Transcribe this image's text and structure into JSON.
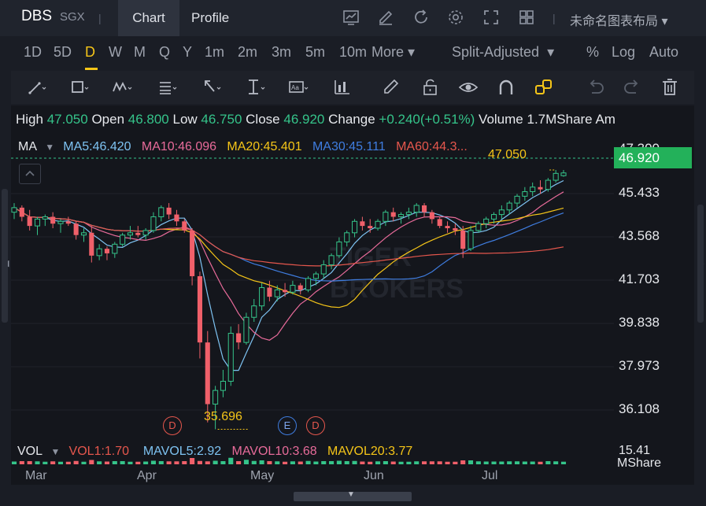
{
  "header": {
    "symbol": "DBS",
    "exchange": "SGX",
    "separator": "|",
    "tabs": [
      "Chart",
      "Profile"
    ],
    "layout_name": "未命名图表布局",
    "icons": [
      "chart-compare-icon",
      "draw-icon",
      "refresh-icon",
      "settings-icon",
      "fullscreen-icon",
      "grid-layout-icon"
    ]
  },
  "periods": [
    "1D",
    "5D",
    "D",
    "W",
    "M",
    "Q",
    "Y",
    "1m",
    "2m",
    "3m",
    "5m",
    "10m"
  ],
  "period_active": "D",
  "period_more": "More",
  "options": {
    "adjust": "Split-Adjusted",
    "percent": "%",
    "log": "Log",
    "auto": "Auto"
  },
  "tools": [
    "line-tool-icon",
    "rectangle-tool-icon",
    "pattern-tool-icon",
    "fib-tool-icon",
    "arrow-tool-icon",
    "measure-tool-icon",
    "text-tool-icon",
    "indicator-icon",
    "pencil-icon",
    "lock-icon",
    "eye-icon",
    "magnet-icon",
    "link-icon",
    "undo-icon",
    "redo-icon",
    "trash-icon"
  ],
  "info": {
    "high_label": "High",
    "high": "47.050",
    "open_label": "Open",
    "open": "46.800",
    "low_label": "Low",
    "low": "46.750",
    "close_label": "Close",
    "close": "46.920",
    "change_label": "Change",
    "change": "+0.240(+0.51%)",
    "volume_label": "Volume",
    "volume": "1.7MShare",
    "amount_label": "Am"
  },
  "ma": {
    "label": "MA",
    "ma5": "MA5:46.420",
    "ma10": "MA10:46.096",
    "ma20": "MA20:45.401",
    "ma30": "MA30:45.111",
    "ma60": "MA60:44.3..."
  },
  "price_axis": [
    "47.300",
    "45.433",
    "43.568",
    "41.703",
    "39.838",
    "37.973",
    "36.108"
  ],
  "current_price": "46.920",
  "high_marker": "47.050",
  "low_marker": "35.696",
  "volume": {
    "label": "VOL",
    "vol1": "VOL1:1.70",
    "mavol5": "MAVOL5:2.92",
    "mavol10": "MAVOL10:3.68",
    "mavol20": "MAVOL20:3.77",
    "axis_top": "15.41",
    "unit": "MShare"
  },
  "x_axis": [
    "Mar",
    "Apr",
    "May",
    "Jun",
    "Jul"
  ],
  "event_markers": [
    "D",
    "E",
    "D"
  ],
  "watermark": [
    "TIGER",
    "BROKERS"
  ],
  "colors": {
    "up": "#35c48a",
    "down": "#f0606a",
    "ma5": "#7ec3f2",
    "ma10": "#e86b9a",
    "ma20": "#f5c518",
    "ma30": "#3f7de0",
    "ma60": "#e6574d",
    "accent": "#f5c518"
  },
  "chart_data": {
    "type": "candlestick",
    "x": [
      "Mar",
      "Apr",
      "May",
      "Jun",
      "Jul"
    ],
    "ylim": [
      35.2,
      47.6
    ],
    "candles": [
      [
        45.2,
        45.6,
        44.9,
        45.4
      ],
      [
        45.4,
        45.5,
        44.8,
        45.0
      ],
      [
        45.0,
        45.3,
        44.4,
        44.6
      ],
      [
        44.6,
        45.0,
        44.2,
        44.9
      ],
      [
        44.9,
        45.1,
        44.6,
        45.0
      ],
      [
        45.0,
        45.2,
        44.5,
        44.7
      ],
      [
        44.7,
        44.9,
        44.3,
        44.8
      ],
      [
        44.8,
        45.0,
        44.6,
        44.7
      ],
      [
        44.7,
        44.8,
        44.0,
        44.2
      ],
      [
        44.2,
        44.5,
        43.9,
        44.3
      ],
      [
        44.3,
        44.6,
        43.0,
        43.3
      ],
      [
        43.3,
        43.8,
        43.1,
        43.6
      ],
      [
        43.6,
        43.7,
        43.1,
        43.4
      ],
      [
        43.4,
        43.9,
        43.2,
        43.8
      ],
      [
        43.8,
        44.3,
        43.7,
        44.2
      ],
      [
        44.2,
        44.6,
        44.0,
        44.3
      ],
      [
        44.3,
        44.6,
        44.1,
        44.2
      ],
      [
        44.2,
        44.5,
        44.0,
        44.4
      ],
      [
        44.4,
        45.2,
        44.3,
        45.0
      ],
      [
        45.0,
        45.5,
        44.8,
        45.4
      ],
      [
        45.4,
        45.6,
        44.9,
        45.1
      ],
      [
        45.1,
        45.3,
        44.6,
        44.8
      ],
      [
        44.8,
        44.9,
        44.3,
        44.4
      ],
      [
        44.4,
        44.5,
        42.0,
        42.4
      ],
      [
        42.4,
        42.6,
        38.8,
        39.5
      ],
      [
        39.5,
        40.0,
        36.0,
        36.8
      ],
      [
        36.8,
        37.6,
        35.7,
        37.4
      ],
      [
        37.4,
        38.3,
        37.1,
        37.8
      ],
      [
        37.8,
        40.2,
        37.6,
        39.9
      ],
      [
        39.9,
        40.3,
        39.2,
        39.5
      ],
      [
        39.5,
        40.8,
        39.4,
        40.6
      ],
      [
        40.6,
        41.4,
        40.4,
        41.1
      ],
      [
        41.1,
        42.1,
        40.9,
        41.9
      ],
      [
        41.9,
        42.2,
        41.3,
        41.5
      ],
      [
        41.5,
        42.0,
        41.3,
        41.8
      ],
      [
        41.8,
        42.1,
        41.5,
        41.7
      ],
      [
        41.7,
        42.2,
        41.6,
        42.0
      ],
      [
        42.0,
        42.1,
        41.6,
        41.8
      ],
      [
        41.8,
        42.4,
        41.7,
        42.3
      ],
      [
        42.3,
        42.6,
        42.0,
        42.5
      ],
      [
        42.5,
        43.1,
        42.3,
        42.9
      ],
      [
        42.9,
        43.4,
        42.7,
        43.3
      ],
      [
        43.3,
        44.1,
        43.2,
        43.9
      ],
      [
        43.9,
        44.4,
        43.7,
        44.3
      ],
      [
        44.3,
        44.9,
        44.1,
        44.8
      ],
      [
        44.8,
        45.0,
        44.4,
        44.6
      ],
      [
        44.6,
        44.9,
        44.3,
        44.5
      ],
      [
        44.5,
        44.9,
        44.4,
        44.8
      ],
      [
        44.8,
        45.3,
        44.6,
        45.2
      ],
      [
        45.2,
        45.4,
        44.8,
        45.0
      ],
      [
        45.0,
        45.2,
        44.7,
        45.1
      ],
      [
        45.1,
        45.4,
        44.9,
        45.2
      ],
      [
        45.2,
        45.6,
        45.0,
        45.5
      ],
      [
        45.5,
        45.6,
        45.0,
        45.2
      ],
      [
        45.2,
        45.3,
        44.7,
        44.9
      ],
      [
        44.9,
        45.0,
        44.5,
        44.6
      ],
      [
        44.6,
        44.8,
        44.3,
        44.5
      ],
      [
        44.5,
        44.7,
        44.2,
        44.4
      ],
      [
        44.4,
        44.6,
        43.2,
        43.6
      ],
      [
        43.6,
        44.6,
        43.5,
        44.4
      ],
      [
        44.4,
        44.8,
        44.3,
        44.7
      ],
      [
        44.7,
        45.0,
        44.5,
        44.9
      ],
      [
        44.9,
        45.2,
        44.7,
        45.1
      ],
      [
        45.1,
        45.5,
        44.9,
        45.3
      ],
      [
        45.3,
        45.7,
        45.1,
        45.6
      ],
      [
        45.6,
        46.0,
        45.4,
        45.9
      ],
      [
        45.9,
        46.3,
        45.7,
        46.1
      ],
      [
        46.1,
        46.5,
        45.9,
        46.3
      ],
      [
        46.3,
        46.6,
        46.0,
        46.2
      ],
      [
        46.2,
        46.7,
        46.1,
        46.6
      ],
      [
        46.6,
        47.05,
        46.5,
        46.9
      ],
      [
        46.8,
        47.05,
        46.75,
        46.92
      ]
    ],
    "series": [
      {
        "name": "MA5",
        "values": []
      },
      {
        "name": "MA10",
        "values": []
      },
      {
        "name": "MA20",
        "values": []
      },
      {
        "name": "MA30",
        "values": []
      },
      {
        "name": "MA60",
        "values": []
      }
    ]
  }
}
